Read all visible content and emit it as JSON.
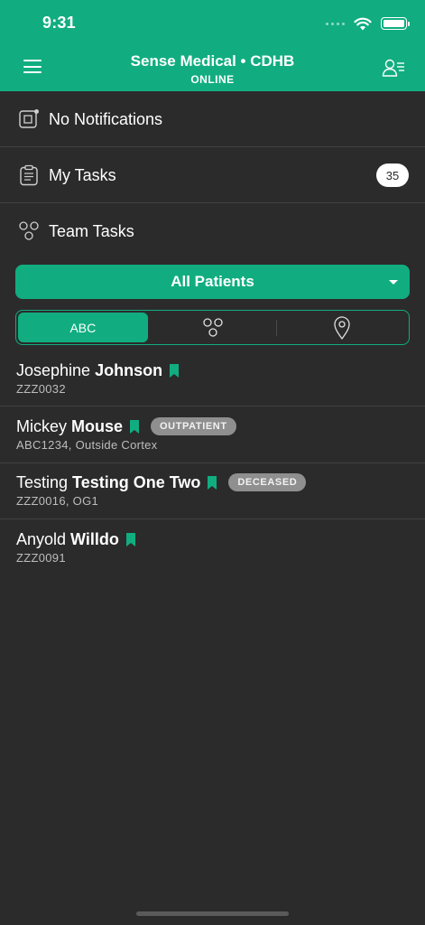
{
  "status_bar": {
    "time": "9:31"
  },
  "header": {
    "title": "Sense Medical • CDHB",
    "subtitle": "ONLINE",
    "brand_color": "#11ad80"
  },
  "nav": {
    "notifications": {
      "label": "No Notifications",
      "icon": "notification-icon"
    },
    "my_tasks": {
      "label": "My Tasks",
      "count": "35",
      "icon": "clipboard-icon"
    },
    "team_tasks": {
      "label": "Team Tasks",
      "icon": "team-icon"
    }
  },
  "patient_filter": {
    "selected": "All Patients"
  },
  "sort_segments": [
    {
      "label": "ABC",
      "active": true
    },
    {
      "icon": "team-sort-icon",
      "active": false
    },
    {
      "icon": "location-pin-icon",
      "active": false
    }
  ],
  "patients": [
    {
      "first": "Josephine",
      "last": "Johnson",
      "meta": "ZZZ0032",
      "tag": ""
    },
    {
      "first": "Mickey",
      "last": "Mouse",
      "meta": "ABC1234, Outside Cortex",
      "tag": "OUTPATIENT"
    },
    {
      "first": "Testing",
      "last": "Testing One Two",
      "meta": "ZZZ0016, OG1",
      "tag": "DECEASED"
    },
    {
      "first": "Anyold",
      "last": "Willdo",
      "meta": "ZZZ0091",
      "tag": ""
    }
  ]
}
